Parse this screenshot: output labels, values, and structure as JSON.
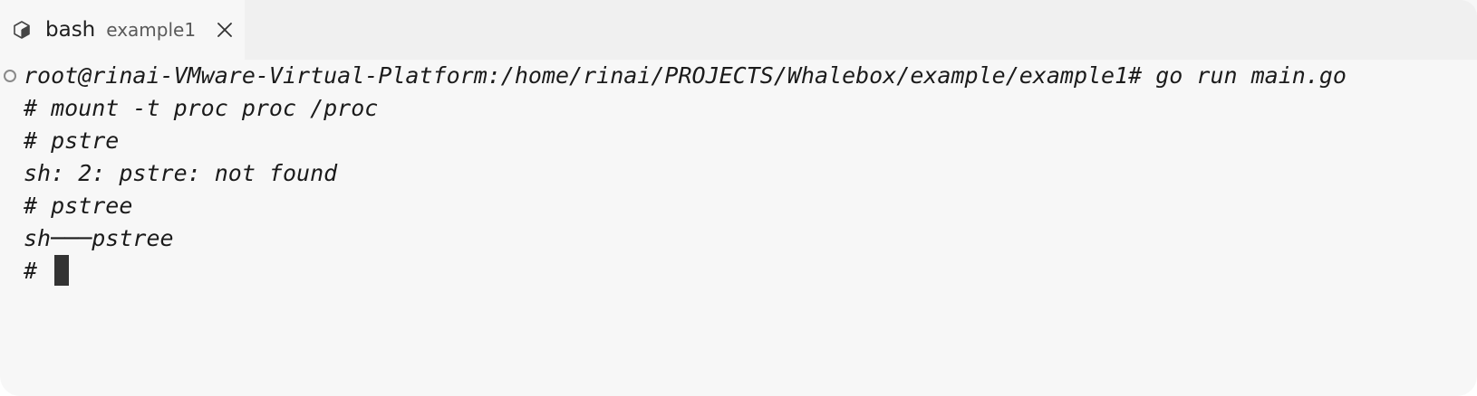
{
  "tab": {
    "icon": "terminal-icon",
    "title": "bash",
    "description": "example1",
    "close_icon": "close-icon"
  },
  "terminal": {
    "lines": [
      "root@rinai-VMware-Virtual-Platform:/home/rinai/PROJECTS/Whalebox/example/example1# go run main.go",
      "# mount -t proc proc /proc",
      "# pstre",
      "sh: 2: pstre: not found",
      "# pstree",
      "sh───pstree"
    ],
    "prompt": "# "
  }
}
